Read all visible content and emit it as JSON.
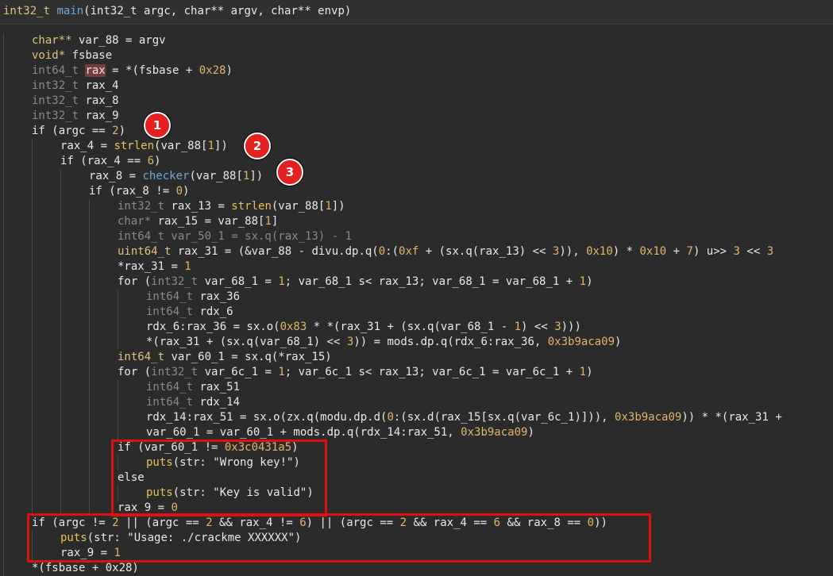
{
  "header": {
    "ret_type": "int32_t",
    "func_name": "main",
    "params": "(int32_t argc, char** argv, char** envp)"
  },
  "code_lines": [
    {
      "indent": 0,
      "tokens": [
        [
          "t",
          "char**"
        ],
        [
          "k",
          " var_88 = argv"
        ]
      ]
    },
    {
      "indent": 0,
      "tokens": [
        [
          "t",
          "void*"
        ],
        [
          "k",
          " fsbase"
        ]
      ]
    },
    {
      "indent": 0,
      "tokens": [
        [
          "d",
          "int64_t "
        ],
        [
          "hl",
          "rax"
        ],
        [
          "k",
          " = *(fsbase + "
        ],
        [
          "n",
          "0x28"
        ],
        [
          "k",
          ")"
        ]
      ]
    },
    {
      "indent": 0,
      "tokens": [
        [
          "d",
          "int32_t "
        ],
        [
          "k",
          "rax_4"
        ]
      ]
    },
    {
      "indent": 0,
      "tokens": [
        [
          "d",
          "int32_t "
        ],
        [
          "k",
          "rax_8"
        ]
      ]
    },
    {
      "indent": 0,
      "tokens": [
        [
          "d",
          "int32_t "
        ],
        [
          "k",
          "rax_9"
        ]
      ]
    },
    {
      "indent": 0,
      "tokens": [
        [
          "k",
          "if (argc == "
        ],
        [
          "n",
          "2"
        ],
        [
          "k",
          ")"
        ]
      ]
    },
    {
      "indent": 1,
      "tokens": [
        [
          "k",
          "rax_4 = "
        ],
        [
          "f",
          "strlen"
        ],
        [
          "k",
          "(var_88["
        ],
        [
          "n",
          "1"
        ],
        [
          "k",
          "])"
        ]
      ]
    },
    {
      "indent": 1,
      "tokens": [
        [
          "k",
          "if (rax_4 == "
        ],
        [
          "n",
          "6"
        ],
        [
          "k",
          ")"
        ]
      ]
    },
    {
      "indent": 2,
      "tokens": [
        [
          "k",
          "rax_8 = "
        ],
        [
          "fn",
          "checker"
        ],
        [
          "k",
          "(var_88["
        ],
        [
          "n",
          "1"
        ],
        [
          "k",
          "])"
        ]
      ]
    },
    {
      "indent": 2,
      "tokens": [
        [
          "k",
          "if (rax_8 != "
        ],
        [
          "n",
          "0"
        ],
        [
          "k",
          ")"
        ]
      ]
    },
    {
      "indent": 3,
      "tokens": [
        [
          "d",
          "int32_t "
        ],
        [
          "k",
          "rax_13 = "
        ],
        [
          "f",
          "strlen"
        ],
        [
          "k",
          "(var_88["
        ],
        [
          "n",
          "1"
        ],
        [
          "k",
          "])"
        ]
      ]
    },
    {
      "indent": 3,
      "tokens": [
        [
          "d",
          "char* "
        ],
        [
          "k",
          "rax_15 = var_88["
        ],
        [
          "n",
          "1"
        ],
        [
          "k",
          "]"
        ]
      ]
    },
    {
      "indent": 3,
      "tokens": [
        [
          "d",
          "int64_t var_50_1 = sx.q(rax_13) - 1"
        ]
      ]
    },
    {
      "indent": 3,
      "tokens": [
        [
          "t",
          "uint64_t"
        ],
        [
          "k",
          " rax_31 = (&var_88 - divu.dp.q("
        ],
        [
          "n",
          "0"
        ],
        [
          "k",
          ":("
        ],
        [
          "n",
          "0xf"
        ],
        [
          "k",
          " + (sx.q(rax_13) << "
        ],
        [
          "n",
          "3"
        ],
        [
          "k",
          ")), "
        ],
        [
          "n",
          "0x10"
        ],
        [
          "k",
          ") * "
        ],
        [
          "n",
          "0x10"
        ],
        [
          "k",
          " + "
        ],
        [
          "n",
          "7"
        ],
        [
          "k",
          ") u>> "
        ],
        [
          "n",
          "3"
        ],
        [
          "k",
          " << "
        ],
        [
          "n",
          "3"
        ]
      ]
    },
    {
      "indent": 3,
      "tokens": [
        [
          "k",
          "*rax_31 = "
        ],
        [
          "n",
          "1"
        ]
      ]
    },
    {
      "indent": 3,
      "tokens": [
        [
          "k",
          "for ("
        ],
        [
          "d",
          "int32_t "
        ],
        [
          "k",
          "var_68_1 = "
        ],
        [
          "n",
          "1"
        ],
        [
          "k",
          "; var_68_1 s< rax_13; var_68_1 = var_68_1 + "
        ],
        [
          "n",
          "1"
        ],
        [
          "k",
          ")"
        ]
      ]
    },
    {
      "indent": 4,
      "tokens": [
        [
          "d",
          "int64_t "
        ],
        [
          "k",
          "rax_36"
        ]
      ]
    },
    {
      "indent": 4,
      "tokens": [
        [
          "d",
          "int64_t "
        ],
        [
          "k",
          "rdx_6"
        ]
      ]
    },
    {
      "indent": 4,
      "tokens": [
        [
          "k",
          "rdx_6:rax_36 = sx.o("
        ],
        [
          "n",
          "0x83"
        ],
        [
          "k",
          " * *(rax_31 + (sx.q(var_68_1 - "
        ],
        [
          "n",
          "1"
        ],
        [
          "k",
          ") << "
        ],
        [
          "n",
          "3"
        ],
        [
          "k",
          ")))"
        ]
      ]
    },
    {
      "indent": 4,
      "tokens": [
        [
          "k",
          "*(rax_31 + (sx.q(var_68_1) << "
        ],
        [
          "n",
          "3"
        ],
        [
          "k",
          ")) = mods.dp.q(rdx_6:rax_36, "
        ],
        [
          "n",
          "0x3b9aca09"
        ],
        [
          "k",
          ")"
        ]
      ]
    },
    {
      "indent": 3,
      "tokens": [
        [
          "t",
          "int64_t"
        ],
        [
          "k",
          " var_60_1 = sx.q(*rax_15)"
        ]
      ]
    },
    {
      "indent": 3,
      "tokens": [
        [
          "k",
          "for ("
        ],
        [
          "d",
          "int32_t "
        ],
        [
          "k",
          "var_6c_1 = "
        ],
        [
          "n",
          "1"
        ],
        [
          "k",
          "; var_6c_1 s< rax_13; var_6c_1 = var_6c_1 + "
        ],
        [
          "n",
          "1"
        ],
        [
          "k",
          ")"
        ]
      ]
    },
    {
      "indent": 4,
      "tokens": [
        [
          "d",
          "int64_t "
        ],
        [
          "k",
          "rax_51"
        ]
      ]
    },
    {
      "indent": 4,
      "tokens": [
        [
          "d",
          "int64_t "
        ],
        [
          "k",
          "rdx_14"
        ]
      ]
    },
    {
      "indent": 4,
      "tokens": [
        [
          "k",
          "rdx_14:rax_51 = sx.o(zx.q(modu.dp.d("
        ],
        [
          "n",
          "0"
        ],
        [
          "k",
          ":(sx.d(rax_15[sx.q(var_6c_1)])), "
        ],
        [
          "n",
          "0x3b9aca09"
        ],
        [
          "k",
          ")) * *(rax_31 +"
        ]
      ]
    },
    {
      "indent": 4,
      "tokens": [
        [
          "k",
          "var_60_1 = var_60_1 + mods.dp.q(rdx_14:rax_51, "
        ],
        [
          "n",
          "0x3b9aca09"
        ],
        [
          "k",
          ")"
        ]
      ]
    },
    {
      "indent": 3,
      "tokens": [
        [
          "k",
          "if (var_60_1 != "
        ],
        [
          "n",
          "0x3c0431a5"
        ],
        [
          "k",
          ")"
        ]
      ]
    },
    {
      "indent": 4,
      "tokens": [
        [
          "f",
          "puts"
        ],
        [
          "k",
          "(str: "
        ],
        [
          "s",
          "\"Wrong key!\""
        ],
        [
          "k",
          ")"
        ]
      ]
    },
    {
      "indent": 3,
      "tokens": [
        [
          "k",
          "else"
        ]
      ]
    },
    {
      "indent": 4,
      "tokens": [
        [
          "f",
          "puts"
        ],
        [
          "k",
          "(str: "
        ],
        [
          "s",
          "\"Key is valid\""
        ],
        [
          "k",
          ")"
        ]
      ]
    },
    {
      "indent": 3,
      "tokens": [
        [
          "k",
          "rax_9 = "
        ],
        [
          "n",
          "0"
        ]
      ]
    },
    {
      "indent": 0,
      "tokens": [
        [
          "k",
          "if (argc != "
        ],
        [
          "n",
          "2"
        ],
        [
          "k",
          " || (argc == "
        ],
        [
          "n",
          "2"
        ],
        [
          "k",
          " && rax_4 != "
        ],
        [
          "n",
          "6"
        ],
        [
          "k",
          ") || (argc == "
        ],
        [
          "n",
          "2"
        ],
        [
          "k",
          " && rax_4 == "
        ],
        [
          "n",
          "6"
        ],
        [
          "k",
          " && rax_8 == "
        ],
        [
          "n",
          "0"
        ],
        [
          "k",
          "))"
        ]
      ]
    },
    {
      "indent": 1,
      "tokens": [
        [
          "f",
          "puts"
        ],
        [
          "k",
          "(str: "
        ],
        [
          "s",
          "\"Usage: ./crackme XXXXXX\""
        ],
        [
          "k",
          ")"
        ]
      ]
    },
    {
      "indent": 1,
      "tokens": [
        [
          "k",
          "rax_9 = "
        ],
        [
          "n",
          "1"
        ]
      ]
    },
    {
      "indent": 0,
      "tokens": [
        [
          "k",
          "*(fsbase + 0x28)"
        ]
      ]
    }
  ],
  "callouts": [
    "1",
    "2",
    "3"
  ],
  "colors": {
    "highlight_box": "#e01010",
    "callout_fill": "#e52020",
    "background": "#2b2b2b"
  }
}
